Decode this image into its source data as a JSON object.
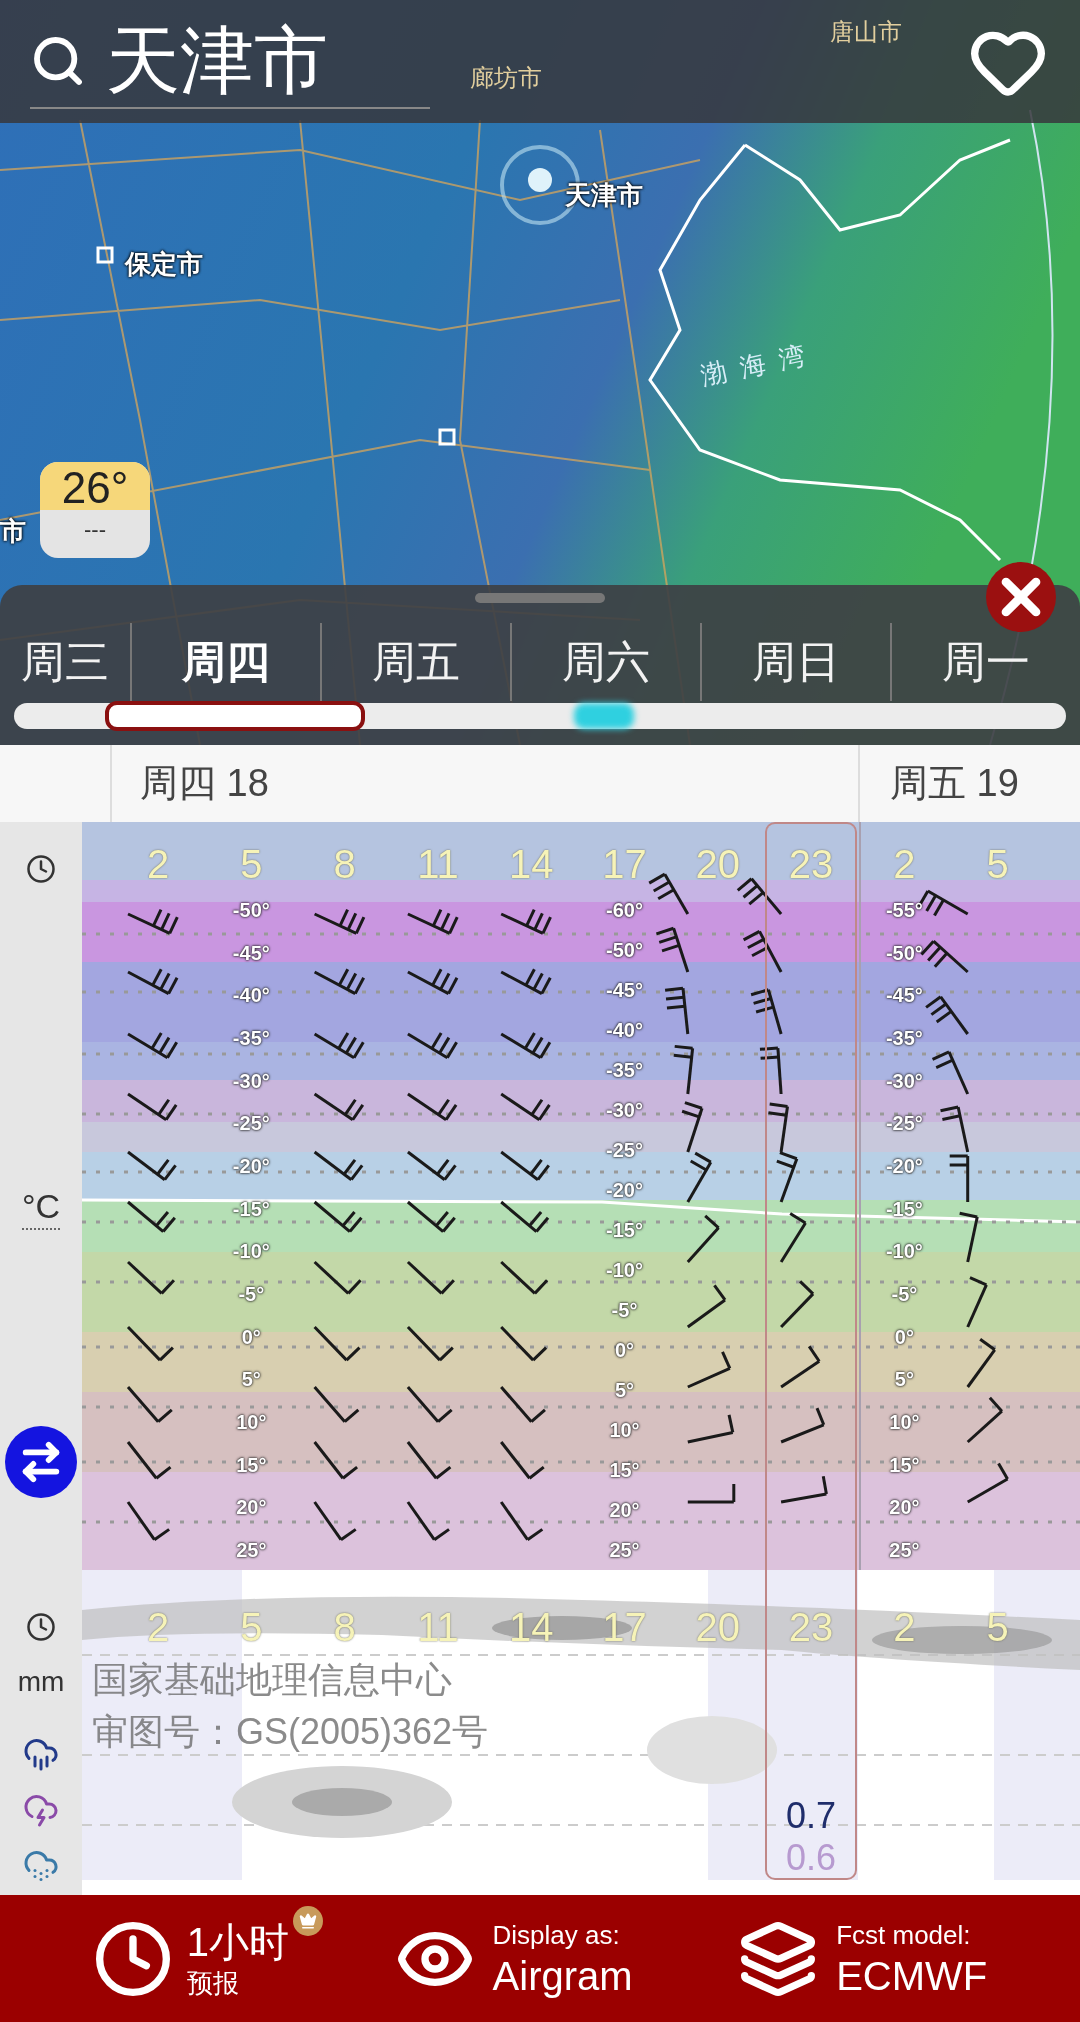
{
  "search": {
    "value": "天津市"
  },
  "map": {
    "labels": [
      {
        "text": "廊坊市",
        "kind": "faint"
      },
      {
        "text": "唐山市",
        "kind": "faint"
      },
      {
        "text": "天津市",
        "kind": "city"
      },
      {
        "text": "保定市",
        "kind": "city"
      },
      {
        "text": "渤海湾",
        "kind": "sea"
      },
      {
        "text": "市",
        "kind": "city"
      }
    ]
  },
  "temperature_badge": {
    "value": "26°",
    "sub": "---"
  },
  "days": [
    {
      "label": "周三",
      "selected": false
    },
    {
      "label": "周四",
      "selected": true
    },
    {
      "label": "周五",
      "selected": false
    },
    {
      "label": "周六",
      "selected": false
    },
    {
      "label": "周日",
      "selected": false
    },
    {
      "label": "周一",
      "selected": false
    }
  ],
  "date_headers": [
    "周四 18",
    "周五 19"
  ],
  "airgram": {
    "unit": "°C",
    "hours": [
      "2",
      "5",
      "8",
      "11",
      "14",
      "17",
      "20",
      "23",
      "2",
      "5"
    ],
    "isotherm_columns": [
      [
        "-50°",
        "-45°",
        "-40°",
        "-35°",
        "-30°",
        "-25°",
        "-20°",
        "-15°",
        "-10°",
        "-5°",
        "0°",
        "5°",
        "10°",
        "15°",
        "20°",
        "25°"
      ],
      [
        "-60°",
        "-50°",
        "-45°",
        "-40°",
        "-35°",
        "-30°",
        "-25°",
        "-20°",
        "-15°",
        "-10°",
        "-5°",
        "0°",
        "5°",
        "10°",
        "15°",
        "20°",
        "25°"
      ],
      [
        "-55°",
        "-50°",
        "-45°",
        "-35°",
        "-30°",
        "-25°",
        "-20°",
        "-15°",
        "-10°",
        "-5°",
        "0°",
        "5°",
        "10°",
        "15°",
        "20°",
        "25°"
      ]
    ]
  },
  "attribution": [
    "国家基础地理信息中心",
    "审图号：GS(2005)362号"
  ],
  "precipitation": {
    "unit": "mm",
    "hours": [
      "2",
      "5",
      "8",
      "11",
      "14",
      "17",
      "20",
      "23",
      "2",
      "5"
    ],
    "values": [
      {
        "text": "0.7",
        "color": "#1f2d6b"
      },
      {
        "text": "0.6",
        "color": "#b79ad0"
      }
    ]
  },
  "bottom_bar": [
    {
      "kind": "interval",
      "title": "1小时",
      "subtitle": "预报",
      "premium": true
    },
    {
      "kind": "display",
      "caption": "Display as:",
      "value": "Airgram"
    },
    {
      "kind": "model",
      "caption": "Fcst model:",
      "value": "ECMWF"
    }
  ]
}
